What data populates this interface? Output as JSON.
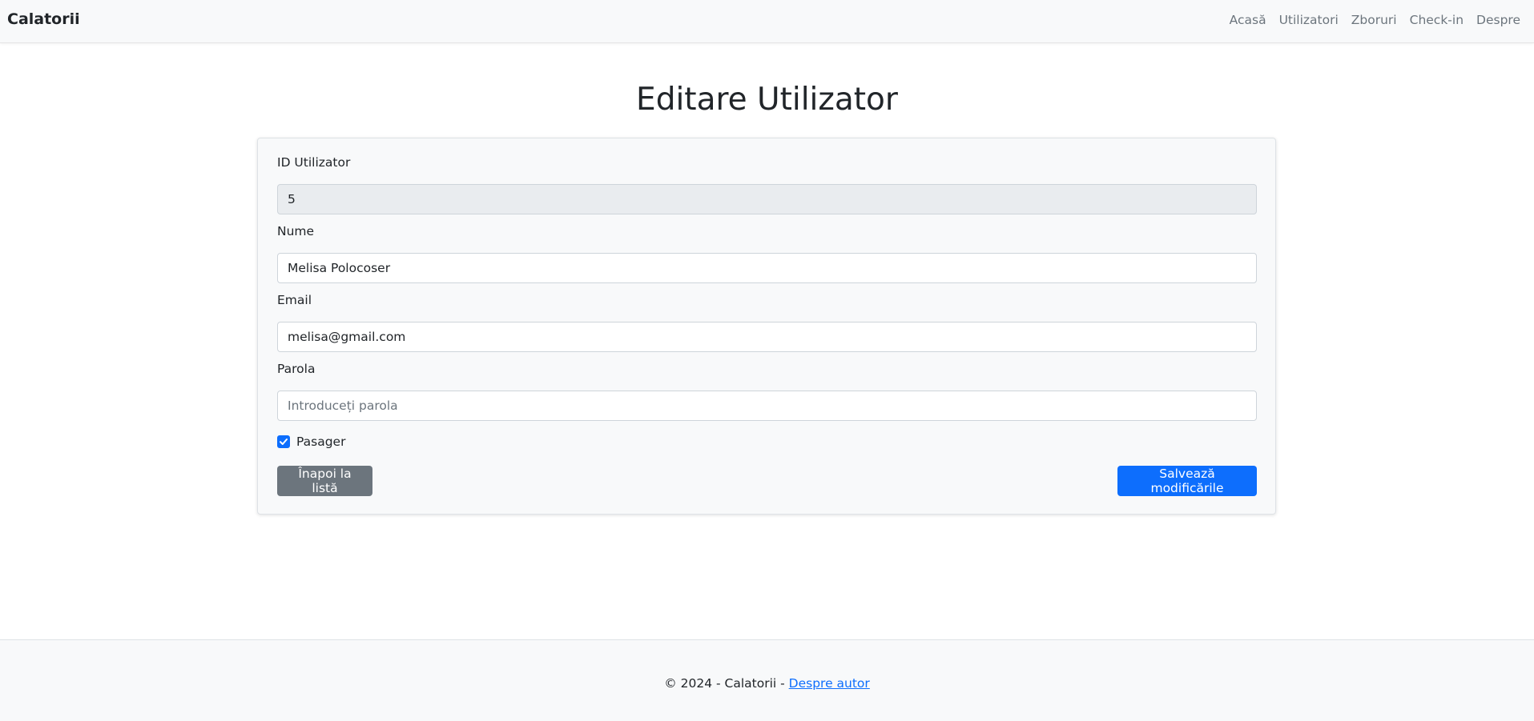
{
  "navbar": {
    "brand": "Calatorii",
    "links": [
      "Acasă",
      "Utilizatori",
      "Zboruri",
      "Check-in",
      "Despre"
    ]
  },
  "page": {
    "title": "Editare Utilizator"
  },
  "form": {
    "id_label": "ID Utilizator",
    "id_value": "5",
    "name_label": "Nume",
    "name_value": "Melisa Polocoser",
    "email_label": "Email",
    "email_value": "melisa@gmail.com",
    "password_label": "Parola",
    "password_placeholder": "Introduceți parola",
    "passenger_label": "Pasager",
    "passenger_checked": true,
    "back_button": "Înapoi la listă",
    "save_button": "Salvează modificările"
  },
  "footer": {
    "text": "© 2024 - Calatorii - ",
    "link": "Despre autor"
  },
  "colors": {
    "primary": "#0d6efd",
    "secondary": "#6c757d",
    "navbar_bg": "#f8f9fa"
  }
}
